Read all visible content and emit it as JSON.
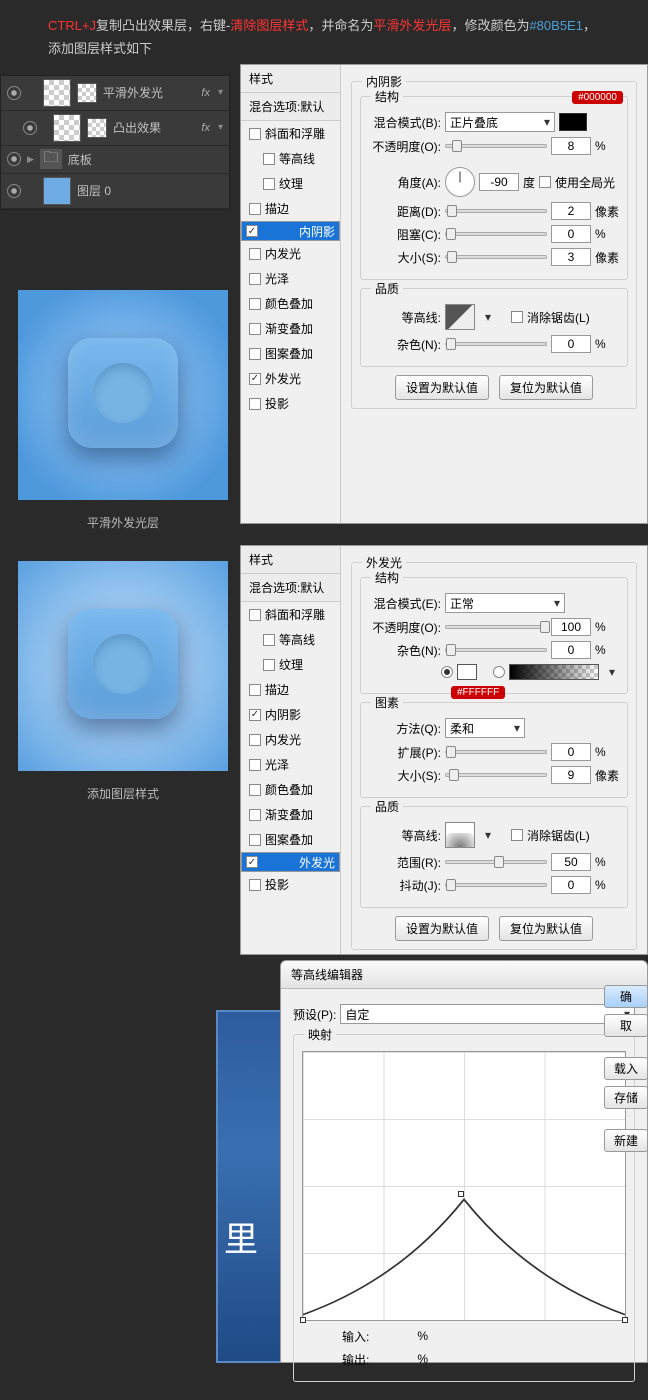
{
  "instruction": {
    "p1": "CTRL+J",
    "p2": "复制凸出效果层，右键-",
    "p3": "清除图层样式",
    "p4": "，并命名为",
    "p5": "平滑外发光层",
    "p6": "，修改颜色为",
    "p7": "#80B5E1",
    "p8": "，添加图层样式如下"
  },
  "layers": [
    {
      "name": "平滑外发光",
      "fx": "fx"
    },
    {
      "name": "凸出效果",
      "fx": "fx"
    },
    {
      "name": "底板"
    },
    {
      "name": "图层 0"
    }
  ],
  "caption1": "平滑外发光层",
  "caption2": "添加图层样式",
  "styles_header": "样式",
  "styles_sub": "混合选项:默认",
  "style_items": [
    {
      "label": "斜面和浮雕",
      "on": false,
      "sub": false
    },
    {
      "label": "等高线",
      "on": false,
      "sub": true
    },
    {
      "label": "纹理",
      "on": false,
      "sub": true
    },
    {
      "label": "描边",
      "on": false,
      "sub": false
    },
    {
      "label": "内阴影",
      "on": true,
      "sub": false
    },
    {
      "label": "内发光",
      "on": false,
      "sub": false
    },
    {
      "label": "光泽",
      "on": false,
      "sub": false
    },
    {
      "label": "颜色叠加",
      "on": false,
      "sub": false
    },
    {
      "label": "渐变叠加",
      "on": false,
      "sub": false
    },
    {
      "label": "图案叠加",
      "on": false,
      "sub": false
    },
    {
      "label": "外发光",
      "on": true,
      "sub": false
    },
    {
      "label": "投影",
      "on": false,
      "sub": false
    }
  ],
  "inner_shadow": {
    "title": "内阴影",
    "struct": "结构",
    "badge": "#000000",
    "blend_lbl": "混合模式(B):",
    "blend_val": "正片叠底",
    "opacity_lbl": "不透明度(O):",
    "opacity_val": "8",
    "pct": "%",
    "angle_lbl": "角度(A):",
    "angle_val": "-90",
    "deg": "度",
    "global": "使用全局光",
    "dist_lbl": "距离(D):",
    "dist_val": "2",
    "px": "像素",
    "choke_lbl": "阻塞(C):",
    "choke_val": "0",
    "size_lbl": "大小(S):",
    "size_val": "3",
    "quality": "品质",
    "contour_lbl": "等高线:",
    "aa": "消除锯齿(L)",
    "noise_lbl": "杂色(N):",
    "noise_val": "0",
    "btn1": "设置为默认值",
    "btn2": "复位为默认值"
  },
  "outer_glow": {
    "title": "外发光",
    "struct": "结构",
    "blend_lbl": "混合模式(E):",
    "blend_val": "正常",
    "opacity_lbl": "不透明度(O):",
    "opacity_val": "100",
    "noise_lbl": "杂色(N):",
    "noise_val": "0",
    "badge": "#FFFFFF",
    "elements": "图素",
    "method_lbl": "方法(Q):",
    "method_val": "柔和",
    "spread_lbl": "扩展(P):",
    "spread_val": "0",
    "size_lbl": "大小(S):",
    "size_val": "9",
    "quality": "品质",
    "contour_lbl": "等高线:",
    "aa": "消除锯齿(L)",
    "range_lbl": "范围(R):",
    "range_val": "50",
    "jitter_lbl": "抖动(J):",
    "jitter_val": "0",
    "btn1": "设置为默认值",
    "btn2": "复位为默认值",
    "pct": "%",
    "px": "像素"
  },
  "contour_editor": {
    "title": "等高线编辑器",
    "preset_lbl": "预设(P):",
    "preset_val": "自定",
    "mapping": "映射",
    "input_lbl": "输入:",
    "output_lbl": "输出:",
    "pct": "%",
    "btn_ok": "确",
    "btn_cancel": "取",
    "btn_load": "载入",
    "btn_save": "存储",
    "btn_new": "新建"
  },
  "blue_char": "里"
}
